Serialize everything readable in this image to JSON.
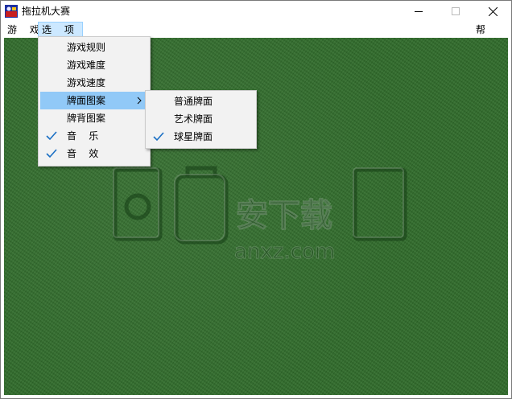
{
  "window": {
    "title": "拖拉机大赛"
  },
  "menubar": {
    "items": [
      {
        "label": "游 戏"
      },
      {
        "label": "选 项"
      }
    ],
    "help_label": "帮 助"
  },
  "options_menu": {
    "items": [
      {
        "label": "游戏规则",
        "checked": false
      },
      {
        "label": "游戏难度",
        "checked": false
      },
      {
        "label": "游戏速度",
        "checked": false
      },
      {
        "label": "牌面图案",
        "checked": false,
        "has_submenu": true
      },
      {
        "label": "牌背图案",
        "checked": false
      },
      {
        "label": "音    乐",
        "checked": true
      },
      {
        "label": "音    效",
        "checked": true
      }
    ]
  },
  "card_face_submenu": {
    "items": [
      {
        "label": "普通牌面",
        "checked": false
      },
      {
        "label": "艺术牌面",
        "checked": false
      },
      {
        "label": "球星牌面",
        "checked": true
      }
    ]
  },
  "watermark": {
    "text": "安下载",
    "subtext": "anxz.com"
  },
  "colors": {
    "felt": "#2f6b2a",
    "highlight": "#91c9f7",
    "menu_active": "#cce8ff",
    "check": "#1a6fc4"
  }
}
